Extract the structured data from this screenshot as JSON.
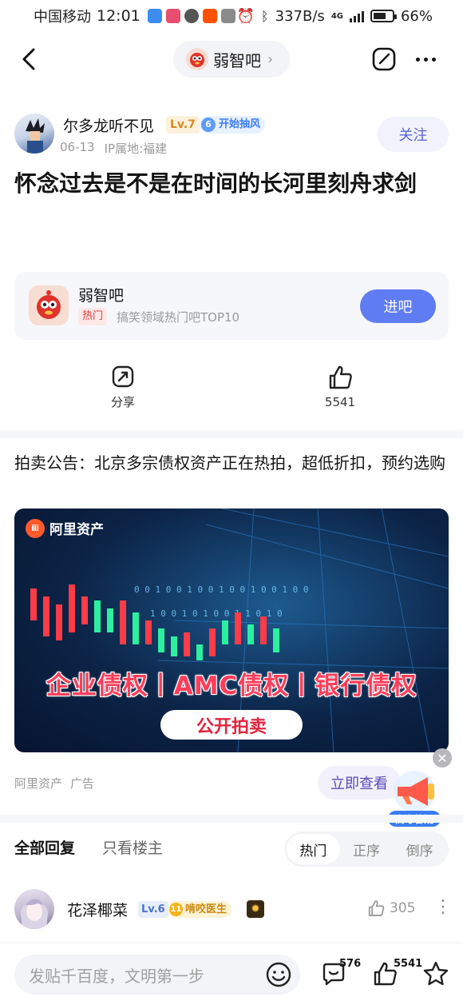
{
  "status_bar": {
    "carrier": "中国移动",
    "time": "12:01",
    "speed": "337B/s",
    "network": "4G",
    "battery": "66%",
    "battery_level": 0.66
  },
  "header": {
    "forum_name": "弱智吧"
  },
  "post": {
    "author": {
      "name": "尔多龙听不见",
      "level": "Lv.7",
      "wind_level": "6",
      "wind_label": "开始抽风",
      "date": "06-13",
      "ip_location": "IP属地:福建"
    },
    "follow_label": "关注",
    "title": "怀念过去是不是在时间的长河里刻舟求剑",
    "forum_card": {
      "name": "弱智吧",
      "hot_tag": "热门",
      "description": "搞笑领域热门吧TOP10",
      "enter_label": "进吧"
    },
    "actions": {
      "share_label": "分享",
      "like_count": "5541"
    }
  },
  "ad": {
    "text": "拍卖公告：北京多宗债权资产正在热拍，超低折扣，预约选购",
    "banner_brand": "阿里资产",
    "banner_headline": "企业债权丨AMC债权丨银行债权",
    "banner_button": "公开拍卖",
    "source": "阿里资产",
    "ad_label": "广告",
    "view_label": "立即查看",
    "float_label": "高考答疑"
  },
  "replies": {
    "tabs": [
      "全部回复",
      "只看楼主"
    ],
    "sort_options": [
      "热门",
      "正序",
      "倒序"
    ],
    "first_reply": {
      "name": "花泽椰菜",
      "level": "Lv.6",
      "title_level": "11",
      "title_label": "啃咬医生",
      "like_count": "305"
    }
  },
  "bottom_bar": {
    "input_placeholder": "发贴千百度，文明第一步",
    "comment_count": "576",
    "like_count": "5541"
  }
}
